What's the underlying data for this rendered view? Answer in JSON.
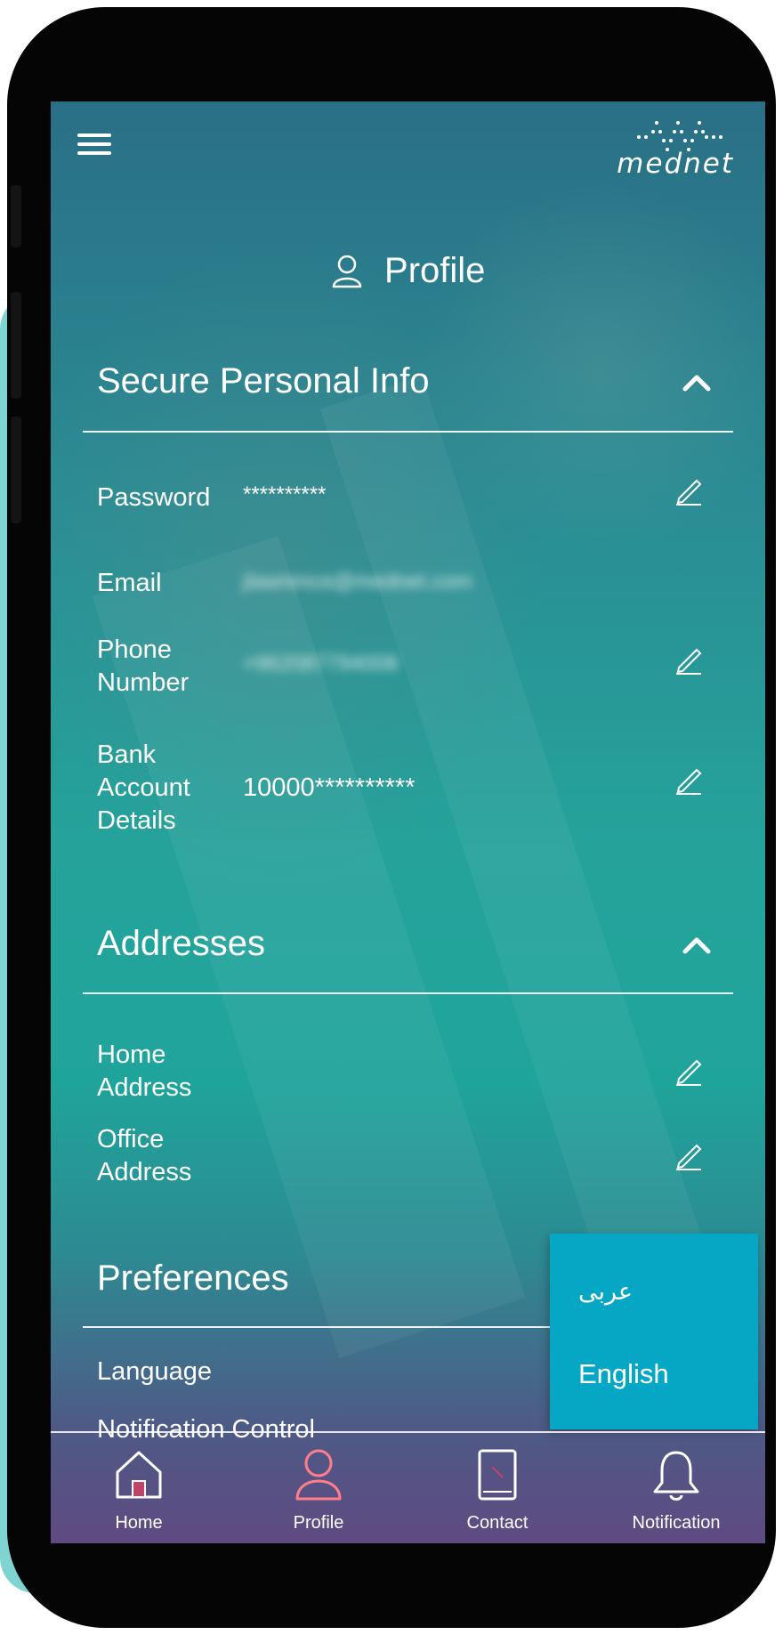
{
  "app": {
    "brand": "mednet",
    "title": "Profile"
  },
  "colors": {
    "accent": "#06a6c5",
    "active_nav": "#ff7e8a",
    "text": "#ffffff"
  },
  "sections": [
    {
      "title": "Secure Personal Info",
      "expanded": true,
      "rows": [
        {
          "label": "Password",
          "value": "**********",
          "editable": true
        },
        {
          "label": "Email",
          "value": "jlawrence@mednet.com",
          "editable": false
        },
        {
          "label": "Phone\nNumber",
          "value": "+962087794008",
          "editable": true
        },
        {
          "label": "Bank\nAccount\nDetails",
          "value": "10000**********",
          "editable": true
        }
      ]
    },
    {
      "title": "Addresses",
      "expanded": true,
      "rows": [
        {
          "label": "Home\nAddress",
          "editable": true
        },
        {
          "label": "Office\nAddress",
          "editable": true
        }
      ]
    },
    {
      "title": "Preferences",
      "rows": [
        {
          "label": "Language"
        },
        {
          "label": "Notification Control"
        }
      ]
    }
  ],
  "language_menu": {
    "options": [
      "عربى",
      "English"
    ]
  },
  "bottom_nav": [
    {
      "label": "Home",
      "icon": "home-icon"
    },
    {
      "label": "Profile",
      "icon": "profile-icon",
      "active": true
    },
    {
      "label": "Contact",
      "icon": "contact-book-icon"
    },
    {
      "label": "Notification",
      "icon": "bell-icon"
    }
  ]
}
